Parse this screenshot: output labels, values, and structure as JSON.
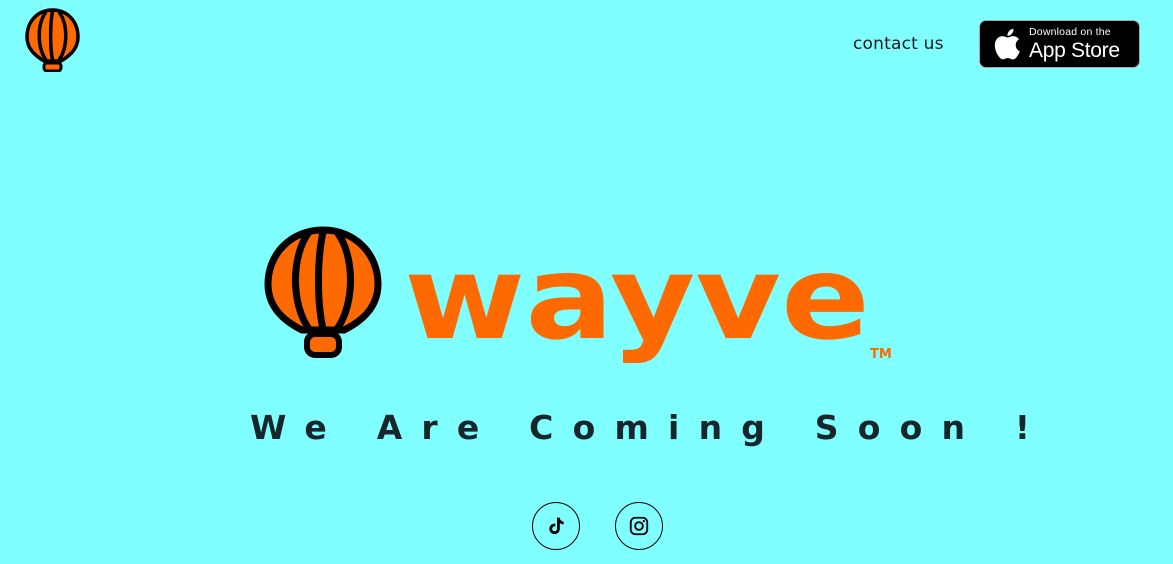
{
  "header": {
    "logo_icon": "balloon-icon",
    "contact_label": "contact us",
    "app_store": {
      "line1": "Download on the",
      "line2": "App Store",
      "icon": "apple-icon"
    }
  },
  "hero": {
    "brand": "wayve",
    "trademark": "TM",
    "tagline": "We Are Coming Soon !"
  },
  "social": [
    {
      "name": "tiktok",
      "icon": "tiktok-icon"
    },
    {
      "name": "instagram",
      "icon": "instagram-icon"
    }
  ],
  "colors": {
    "background": "#7fffff",
    "brand_orange": "#ff6a00",
    "outline": "#000000",
    "text_dark": "#16262a"
  }
}
